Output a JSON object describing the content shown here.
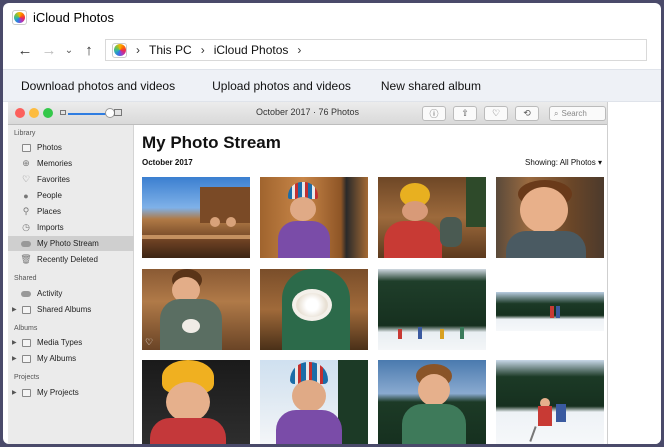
{
  "window": {
    "title": "iCloud Photos"
  },
  "address": {
    "back_icon": "←",
    "forward_icon": "→",
    "recent_icon": "⌄",
    "up_icon": "↑",
    "crumbs": [
      "This PC",
      "iCloud Photos"
    ],
    "separator": "›"
  },
  "commands": {
    "download": "Download photos and videos",
    "upload": "Upload photos and videos",
    "new_shared": "New shared album"
  },
  "mac": {
    "window_title": "October 2017 · 76 Photos",
    "search_placeholder": "Search",
    "buttons": {
      "info": "ⓘ",
      "share": "⇧",
      "favorite": "♡",
      "rotate": "⟲"
    },
    "zoom_level": 0.85
  },
  "sidebar": {
    "library_header": "Library",
    "library": [
      {
        "label": "Photos",
        "icon": "photos-icon"
      },
      {
        "label": "Memories",
        "icon": "memories-icon"
      },
      {
        "label": "Favorites",
        "icon": "heart-icon"
      },
      {
        "label": "People",
        "icon": "person-icon"
      },
      {
        "label": "Places",
        "icon": "pin-icon"
      },
      {
        "label": "Imports",
        "icon": "clock-icon"
      },
      {
        "label": "My Photo Stream",
        "icon": "cloud-icon"
      },
      {
        "label": "Recently Deleted",
        "icon": "trash-icon"
      }
    ],
    "shared_header": "Shared",
    "shared": [
      {
        "label": "Activity",
        "icon": "cloud-icon"
      },
      {
        "label": "Shared Albums",
        "icon": "folder-icon"
      }
    ],
    "albums_header": "Albums",
    "albums": [
      {
        "label": "Media Types",
        "icon": "folder-icon"
      },
      {
        "label": "My Albums",
        "icon": "folder-icon"
      }
    ],
    "projects_header": "Projects",
    "projects": [
      {
        "label": "My Projects",
        "icon": "folder-icon"
      }
    ]
  },
  "main": {
    "title": "My Photo Stream",
    "month": "October 2017",
    "showing": "Showing: All Photos",
    "showing_icon": "▾"
  },
  "colors": {
    "accent": "#2f7de1",
    "close": "#fc605c",
    "minimize": "#fdbc40",
    "zoom": "#34c84a"
  }
}
